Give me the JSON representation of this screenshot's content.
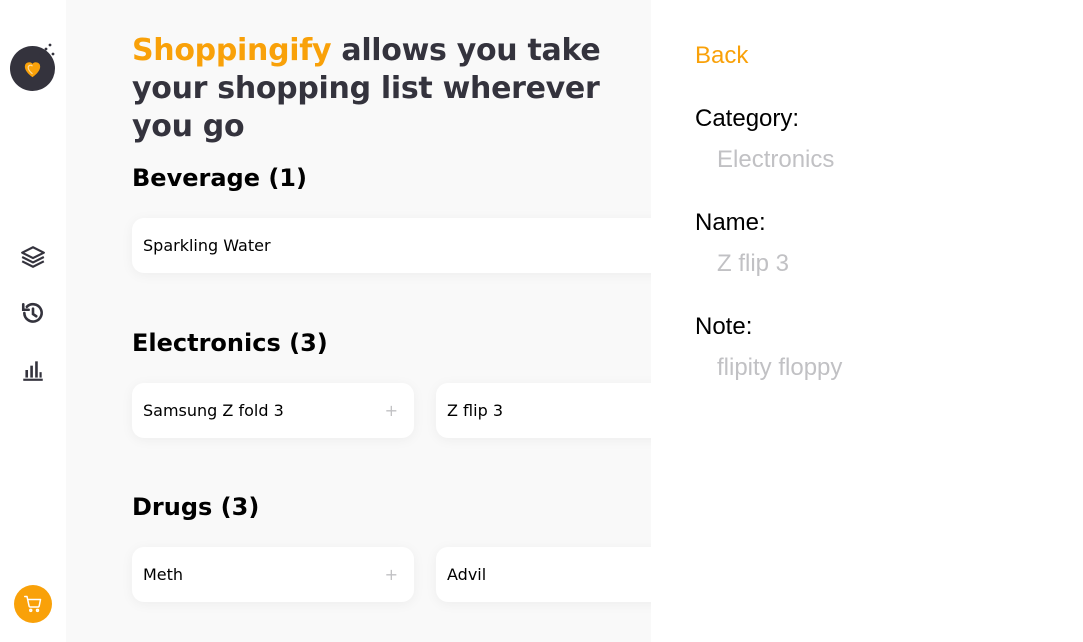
{
  "colors": {
    "accent": "#f9a109",
    "dark": "#34333d",
    "muted": "#c1c1c4",
    "main_bg": "#f9f9f9"
  },
  "sidebar": {
    "logo_icon": "heart-icon",
    "nav": [
      {
        "icon": "layers-icon"
      },
      {
        "icon": "history-icon"
      },
      {
        "icon": "bar-chart-icon"
      }
    ],
    "cart_icon": "cart-icon"
  },
  "header": {
    "brand": "Shoppingify",
    "tagline": " allows you take your shopping list wherever you go"
  },
  "categories": [
    {
      "title": "Beverage (1)",
      "items": [
        {
          "name": "Sparkling Water"
        }
      ]
    },
    {
      "title": "Electronics (3)",
      "items": [
        {
          "name": "Samsung Z fold 3",
          "add": "+"
        },
        {
          "name": "Z flip 3"
        }
      ]
    },
    {
      "title": "Drugs (3)",
      "items": [
        {
          "name": "Meth",
          "add": "+"
        },
        {
          "name": "Advil"
        }
      ]
    }
  ],
  "detail": {
    "back_label": "Back",
    "category_label": "Category:",
    "category_value": "Electronics",
    "name_label": "Name:",
    "name_value": "Z flip 3",
    "note_label": "Note:",
    "note_value": "flipity floppy"
  }
}
